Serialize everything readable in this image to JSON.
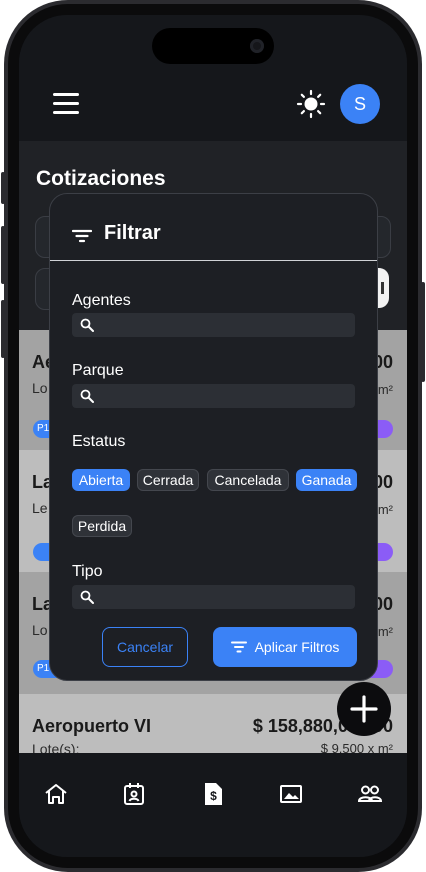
{
  "header": {
    "avatar_initial": "S"
  },
  "page": {
    "title": "Cotizaciones"
  },
  "cards": [
    {
      "title": "Ae",
      "sub": "Lo",
      "price": "00",
      "m2": "m²"
    },
    {
      "title": "La",
      "sub": "Le",
      "price": "00",
      "m2": "m²"
    },
    {
      "title": "La",
      "sub": "Lo",
      "price": "00",
      "m2": "m²"
    },
    {
      "title": "Aeropuerto VI",
      "sub": "Lote(s):",
      "price": "$ 158,880,000.00",
      "m2": "$ 9,500 x m²"
    }
  ],
  "card_badge_1": "P1",
  "card_badge_3": "P1",
  "dialog": {
    "title": "Filtrar",
    "agentes_label": "Agentes",
    "parque_label": "Parque",
    "estatus_label": "Estatus",
    "tipo_label": "Tipo",
    "chips": [
      {
        "label": "Abierta",
        "selected": true
      },
      {
        "label": "Cerrada",
        "selected": false
      },
      {
        "label": "Cancelada",
        "selected": false
      },
      {
        "label": "Ganada",
        "selected": true
      },
      {
        "label": "Perdida",
        "selected": false
      }
    ],
    "cancel_label": "Cancelar",
    "apply_label": "Aplicar Filtros"
  },
  "fab_icon": "plus-icon",
  "bottom_nav": [
    "home-icon",
    "calendar-icon",
    "quote-icon",
    "gallery-icon",
    "users-icon"
  ],
  "colors": {
    "accent": "#3b82f6",
    "purple": "#8b5cf6",
    "background": "#0f1114"
  }
}
